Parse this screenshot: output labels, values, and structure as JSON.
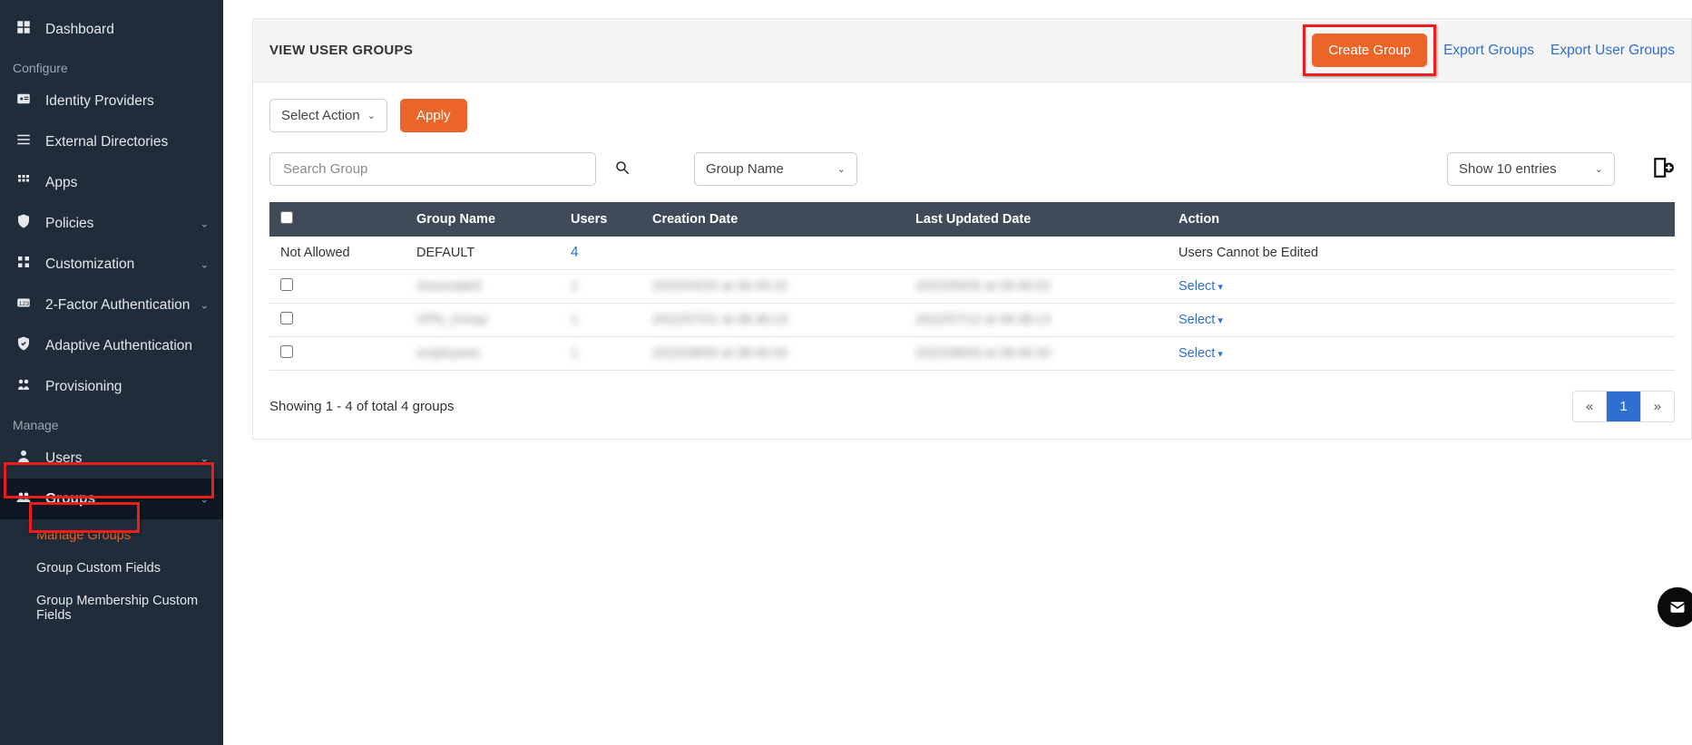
{
  "sidebar": {
    "sections": {
      "top": {
        "dashboard": "Dashboard"
      },
      "configure_label": "Configure",
      "configure": {
        "idp": "Identity Providers",
        "ext_dirs": "External Directories",
        "apps": "Apps",
        "policies": "Policies",
        "customization": "Customization",
        "mfa": "2-Factor Authentication",
        "adaptive": "Adaptive Authentication",
        "provisioning": "Provisioning"
      },
      "manage_label": "Manage",
      "manage": {
        "users": "Users",
        "groups": "Groups",
        "groups_sub": {
          "manage_groups": "Manage Groups",
          "custom_fields": "Group Custom Fields",
          "membership_custom_fields": "Group Membership Custom Fields"
        }
      }
    }
  },
  "header": {
    "title": "VIEW USER GROUPS",
    "create_btn": "Create Group",
    "export_groups": "Export Groups",
    "export_user_groups": "Export User Groups"
  },
  "toolbar": {
    "select_action": "Select Action",
    "apply": "Apply",
    "search_placeholder": "Search Group",
    "filter_field": "Group Name",
    "page_size": "Show 10 entries"
  },
  "table": {
    "columns": {
      "group_name": "Group Name",
      "users": "Users",
      "creation": "Creation Date",
      "updated": "Last Updated Date",
      "action": "Action"
    },
    "rows": [
      {
        "checkbox_text": "Not Allowed",
        "group": "DEFAULT",
        "users": "4",
        "creation": "",
        "updated": "",
        "action": "Users Cannot be Edited",
        "blurred": false,
        "users_link": true,
        "action_plain": true
      },
      {
        "checkbox": true,
        "group": "Associated",
        "users": "1",
        "creation": "2022/04/25 at 06:49:22",
        "updated": "2022/05/05 at 06:46:02",
        "action": "Select",
        "blurred": true
      },
      {
        "checkbox": true,
        "group": "VPN_Group",
        "users": "1",
        "creation": "2022/07/01 at 08:38:13",
        "updated": "2022/07/12 at 08:38:13",
        "action": "Select",
        "blurred": true
      },
      {
        "checkbox": true,
        "group": "employees",
        "users": "1",
        "creation": "2022/08/09 at 08:46:40",
        "updated": "2022/08/09 at 08:46:40",
        "action": "Select",
        "blurred": true
      }
    ]
  },
  "footer": {
    "showing": "Showing 1 - 4 of total 4 groups",
    "prev": "«",
    "page": "1",
    "next": "»"
  }
}
